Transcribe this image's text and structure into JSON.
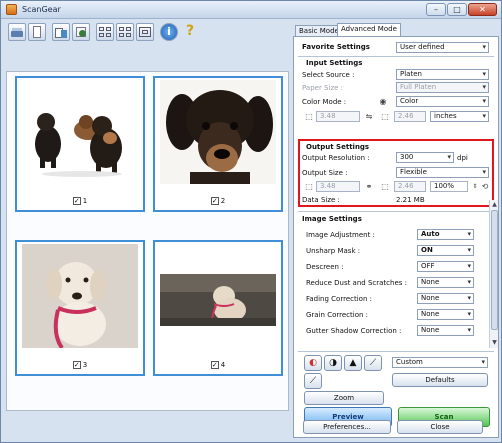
{
  "window": {
    "title": "ScanGear",
    "minimize": "–",
    "maximize": "□",
    "close": "✕"
  },
  "toolbar": {
    "icons": [
      "scanner-icon",
      "blank-page-icon",
      "save-icon",
      "clear-icon",
      "thumbnail-view-icon",
      "crop-frames-icon",
      "whole-image-icon",
      "info-icon",
      "help-icon"
    ]
  },
  "thumbnails": [
    {
      "label": "1",
      "checked": true
    },
    {
      "label": "2",
      "checked": true
    },
    {
      "label": "3",
      "checked": true
    },
    {
      "label": "4",
      "checked": true
    }
  ],
  "tabs": {
    "basic": "Basic Mode",
    "advanced": "Advanced Mode"
  },
  "favorite": {
    "label": "Favorite Settings",
    "value": "User defined"
  },
  "input_settings": {
    "title": "Input Settings",
    "select_source_label": "Select Source :",
    "select_source_value": "Platen",
    "paper_size_label": "Paper Size :",
    "paper_size_value": "Full Platen",
    "color_mode_label": "Color Mode :",
    "color_mode_value": "Color",
    "width_value": "3.48",
    "height_value": "2.46",
    "units_value": "inches"
  },
  "output_settings": {
    "title": "Output Settings",
    "resolution_label": "Output Resolution :",
    "resolution_value": "300",
    "resolution_unit": "dpi",
    "size_label": "Output Size :",
    "size_value": "Flexible",
    "width_value": "3.48",
    "height_value": "2.46",
    "scale_value": "100%",
    "data_size_label": "Data Size :",
    "data_size_value": "2.21 MB"
  },
  "image_settings": {
    "title": "Image Settings",
    "rows": [
      {
        "label": "Image Adjustment :",
        "value": "Auto",
        "bold": true
      },
      {
        "label": "Unsharp Mask :",
        "value": "ON",
        "bold": true
      },
      {
        "label": "Descreen :",
        "value": "OFF",
        "bold": false
      },
      {
        "label": "Reduce Dust and Scratches :",
        "value": "None",
        "bold": false
      },
      {
        "label": "Fading Correction :",
        "value": "None",
        "bold": false
      },
      {
        "label": "Grain Correction :",
        "value": "None",
        "bold": false
      },
      {
        "label": "Gutter Shadow Correction :",
        "value": "None",
        "bold": false
      }
    ]
  },
  "adjustments": {
    "preset_value": "Custom",
    "defaults_label": "Defaults",
    "icons": [
      "color-adjustment-icon",
      "brightness-contrast-icon",
      "histogram-icon",
      "tone-curve-icon",
      "final-review-icon"
    ]
  },
  "actions": {
    "zoom": "Zoom",
    "preview": "Preview",
    "scan": "Scan",
    "preferences": "Preferences...",
    "close": "Close"
  }
}
